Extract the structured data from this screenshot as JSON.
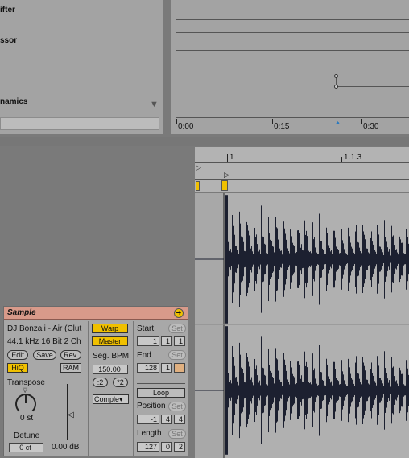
{
  "browser": {
    "items": [
      "ifter",
      "ssor",
      "namics"
    ]
  },
  "automation": {
    "timeline": [
      "0:00",
      "0:15",
      "0:30"
    ]
  },
  "ruler": {
    "marker1": "1",
    "marker2": "1.1.3"
  },
  "sample": {
    "title": "Sample",
    "file_name": "DJ Bonzaii - Air (Clut",
    "file_info": "44.1 kHz 16 Bit 2 Ch",
    "edit_label": "Edit",
    "save_label": "Save",
    "rev_label": "Rev.",
    "hiq_label": "HiQ",
    "ram_label": "RAM",
    "transpose_label": "Transpose",
    "transpose_value": "0 st",
    "detune_label": "Detune",
    "detune_value": "0 ct",
    "gain_value": "0.00 dB",
    "warp_label": "Warp",
    "master_label": "Master",
    "seg_bpm_label": "Seg. BPM",
    "seg_bpm_value": "150.00",
    "half_label": ":2",
    "double_label": "*2",
    "warp_mode": "Comple▾",
    "start_label": "Start",
    "end_label": "End",
    "set_label": "Set",
    "start_values": [
      "1",
      "1",
      "1"
    ],
    "end_values": [
      "128",
      "1",
      ""
    ],
    "loop_label": "Loop",
    "position_label": "Position",
    "position_values": [
      "-1",
      "4",
      "4"
    ],
    "length_label": "Length",
    "length_values": [
      "127",
      "0",
      "2"
    ]
  }
}
